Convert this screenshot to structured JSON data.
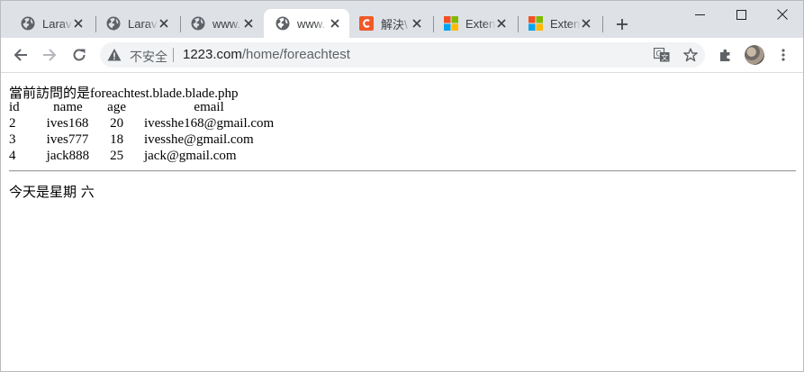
{
  "tabs": [
    {
      "title": "Larav",
      "favicon": "globe-icon",
      "active": false
    },
    {
      "title": "Larav",
      "favicon": "globe-icon",
      "active": false
    },
    {
      "title": "www.",
      "favicon": "globe-icon",
      "active": false
    },
    {
      "title": "www.",
      "favicon": "globe-icon",
      "active": true
    },
    {
      "title": "解決\\",
      "favicon": "c-logo-icon",
      "active": false
    },
    {
      "title": "Exten",
      "favicon": "microsoft-logo-icon",
      "active": false
    },
    {
      "title": "Exten",
      "favicon": "microsoft-logo-icon",
      "active": false
    }
  ],
  "toolbar": {
    "security_label": "不安全",
    "url_host": "1223.com",
    "url_path": "/home/foreachtest"
  },
  "page": {
    "heading": "當前訪問的是foreachtest.blade.blade.php",
    "columns": [
      "id",
      "name",
      "age",
      "email"
    ],
    "rows": [
      {
        "id": "2",
        "name": "ives168",
        "age": "20",
        "email": "ivesshe168@gmail.com"
      },
      {
        "id": "3",
        "name": "ives777",
        "age": "18",
        "email": "ivesshe@gmail.com"
      },
      {
        "id": "4",
        "name": "jack888",
        "age": "25",
        "email": "jack@gmail.com"
      }
    ],
    "today": "今天是星期 六"
  },
  "colors": {
    "tabstrip": "#dee1e6",
    "omnibox": "#f1f3f4",
    "icon": "#5f6368",
    "c_logo": "#f05a28"
  }
}
